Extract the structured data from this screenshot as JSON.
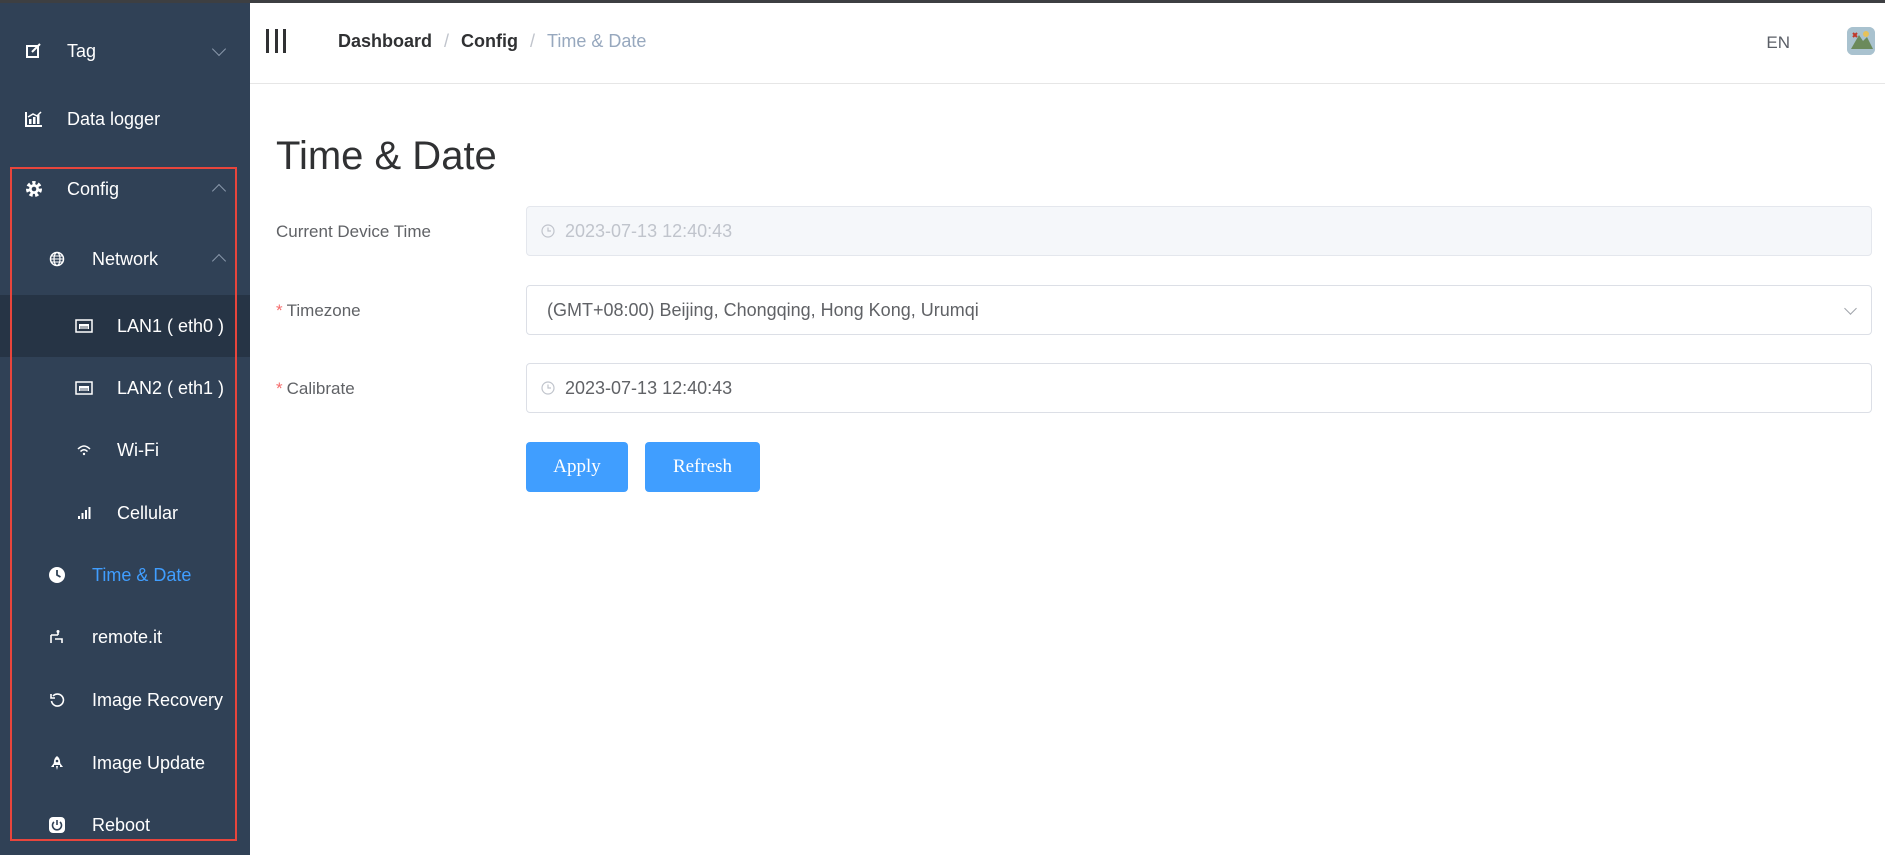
{
  "sidebar": {
    "items": [
      {
        "label": "Tag",
        "icon": "edit-icon"
      },
      {
        "label": "Data logger",
        "icon": "chart-icon"
      },
      {
        "label": "Config",
        "icon": "gear-icon"
      },
      {
        "label": "Network",
        "icon": "globe-icon"
      },
      {
        "label": "LAN1 ( eth0 )",
        "icon": "ethernet-icon"
      },
      {
        "label": "LAN2 ( eth1 )",
        "icon": "ethernet-icon"
      },
      {
        "label": "Wi-Fi",
        "icon": "wifi-icon"
      },
      {
        "label": "Cellular",
        "icon": "signal-icon"
      },
      {
        "label": "Time & Date",
        "icon": "clock-icon"
      },
      {
        "label": "remote.it",
        "icon": "remote-icon"
      },
      {
        "label": "Image Recovery",
        "icon": "refresh-icon"
      },
      {
        "label": "Image Update",
        "icon": "rocket-icon"
      },
      {
        "label": "Reboot",
        "icon": "power-icon"
      }
    ],
    "active_color": "#409eff",
    "background": "#304156"
  },
  "header": {
    "breadcrumb": [
      "Dashboard",
      "Config",
      "Time & Date"
    ],
    "separator": "/",
    "language": "EN"
  },
  "main": {
    "title": "Time & Date",
    "current_time": {
      "label": "Current Device Time",
      "value": "2023-07-13 12:40:43"
    },
    "timezone": {
      "required_mark": "*",
      "label": "Timezone",
      "value": "(GMT+08:00) Beijing, Chongqing, Hong Kong, Urumqi"
    },
    "calibrate": {
      "required_mark": "*",
      "label": "Calibrate",
      "value": "2023-07-13 12:40:43"
    },
    "apply_label": "Apply",
    "refresh_label": "Refresh",
    "primary_color": "#409eff"
  }
}
